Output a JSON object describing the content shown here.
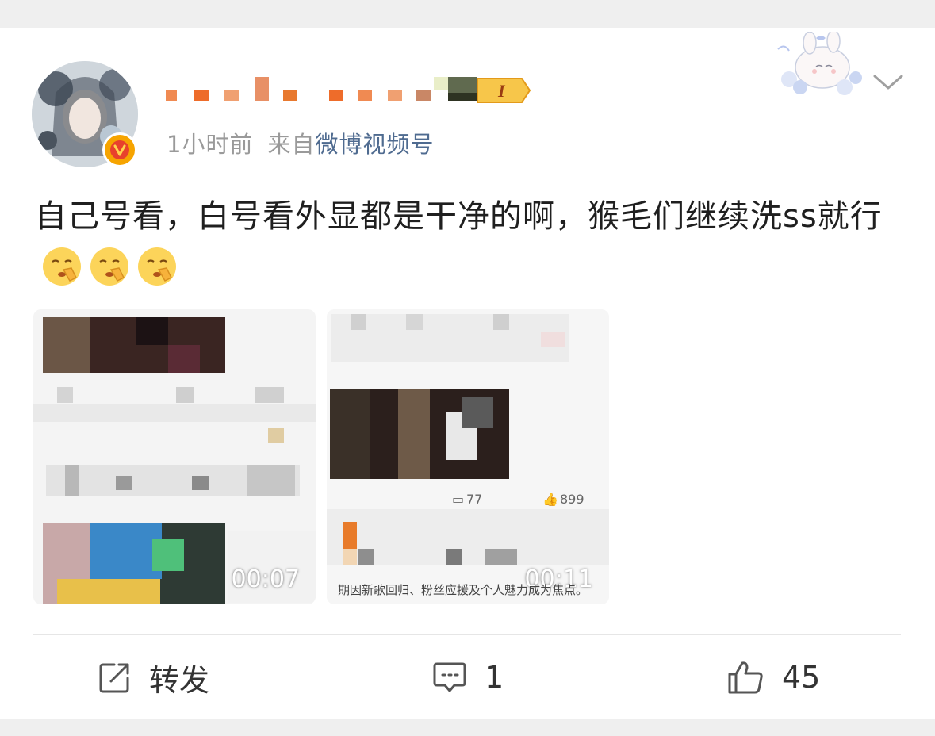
{
  "post": {
    "time": "1小时前",
    "source_prefix": "来自",
    "source": "微博视频号",
    "level_badge": "I",
    "text": "自己号看，白号看外显都是干净的啊，猴毛们继续洗ss就行"
  },
  "thumbnails": [
    {
      "duration": "00:07"
    },
    {
      "duration": "00:11",
      "comments": "77",
      "likes": "899",
      "caption": "期因新歌回归、粉丝应援及个人魅力成为焦点。"
    }
  ],
  "actions": {
    "repost_label": "转发",
    "comment_count": "1",
    "like_count": "45"
  },
  "colors": {
    "source_link": "#4f6b90",
    "meta_gray": "#9a9a9a",
    "verified_badge": "#f6a400"
  }
}
